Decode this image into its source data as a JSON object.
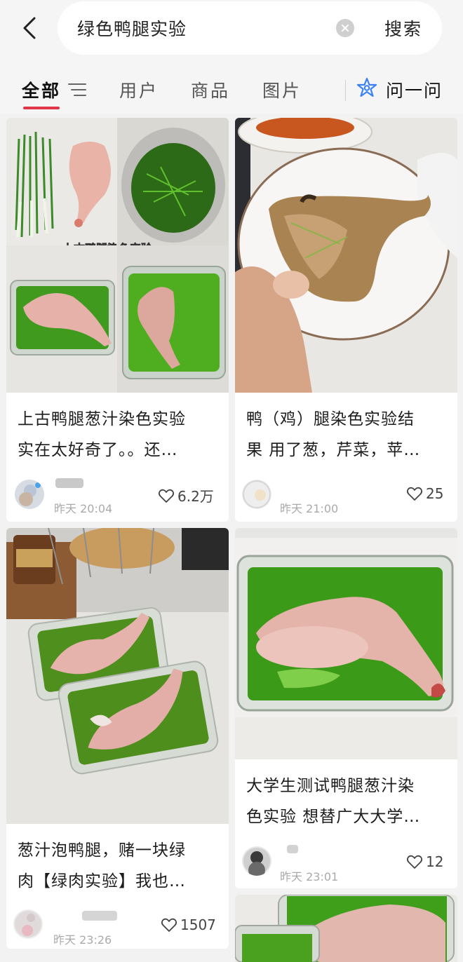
{
  "search": {
    "query": "绿色鸭腿实验",
    "submit_label": "搜索"
  },
  "tabs": {
    "items": [
      {
        "label": "全部"
      },
      {
        "label": "用户"
      },
      {
        "label": "商品"
      },
      {
        "label": "图片"
      }
    ],
    "ask_label": "问一问"
  },
  "feed": {
    "cards": [
      {
        "title_line1": "上古鸭腿葱汁染色实验",
        "title_line2": "实在太好奇了。。还…",
        "image_caption": "上古鸭腿染色实验",
        "time": "昨天 20:04",
        "likes": "6.2万"
      },
      {
        "title_line1": "鸭（鸡）腿染色实验结",
        "title_line2": "果 用了葱，芹菜，苹…",
        "time": "昨天 21:00",
        "likes": "25"
      },
      {
        "title_line1": "葱汁泡鸭腿，赌一块绿",
        "title_line2": "肉【绿肉实验】我也…",
        "time": "昨天 23:26",
        "likes": "1507"
      },
      {
        "title_line1": "大学生测试鸭腿葱汁染",
        "title_line2": "色实验 想替广大大学…",
        "time": "昨天 23:01",
        "likes": "12"
      }
    ]
  },
  "colors": {
    "accent": "#e0364a",
    "ask_icon": "#3b82f6",
    "green_liquid": "#3f9a1e"
  }
}
